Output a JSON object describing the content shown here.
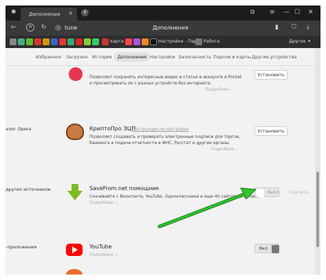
{
  "tab": {
    "title": "Дополнения"
  },
  "address": {
    "url": "tune",
    "page_title": "Дополнения"
  },
  "bookmarks": {
    "items": [
      "карта",
      "Настройки - Пар",
      "Работа"
    ],
    "other": "Другое"
  },
  "nav": [
    "Избранное",
    "Загрузки",
    "История",
    "Дополнения",
    "Настройки",
    "Безопасность",
    "Пароли и карты",
    "Другие устройства"
  ],
  "pocket": {
    "desc_lines": [
      "Позволяет сохранять интересные видео и статьи в аккаунте в Pocket",
      "и просматривать их с разных устройств без интернета."
    ],
    "more": "Подробнее",
    "button": "Установить"
  },
  "crypto": {
    "section": "алог Opera",
    "name": "КриптоПро ЭЦП",
    "link": "Инструкция по настройке",
    "desc_lines": [
      "Позволяет создавать и проверять электронные подписи для торгов,",
      "банкинга и подачи отчетности в ФНС, Росстат и другие органы."
    ],
    "more": "Подробнее",
    "button": "Установить"
  },
  "savefrom": {
    "section": "других источников",
    "name": "SaveFrom.net помощник",
    "desc_lines": [
      "Скачивайте с Вконтакте, YouTube, Одноклассники и еще 40 сайтов за 1 клик."
    ],
    "more": "Подробнее",
    "toggle": "Выкл.",
    "delete": "Удалить"
  },
  "youtube": {
    "section": "-приложения",
    "name": "YouTube",
    "more": "Подробнее",
    "toggle": "Вкл."
  },
  "colors": {
    "accent": "#d0e0ff",
    "arrow": "#2ec52e",
    "pocket": "#e8344e",
    "savefrom": "#7cbc1e",
    "youtube": "#ff0000"
  }
}
